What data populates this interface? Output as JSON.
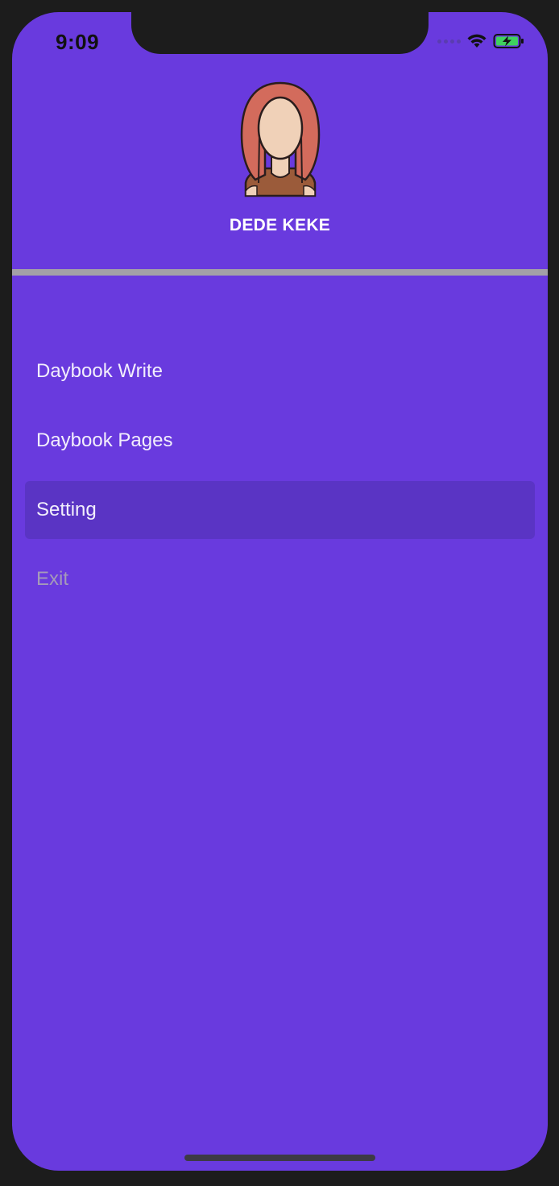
{
  "status_bar": {
    "time": "9:09",
    "icons": [
      "signal-icon",
      "wifi-icon",
      "battery-charging-icon"
    ]
  },
  "drawer": {
    "avatar_icon": "woman-avatar-icon",
    "user_name": "DEDE KEKE",
    "menu": [
      {
        "label": "Daybook Write",
        "state": "normal"
      },
      {
        "label": "Daybook Pages",
        "state": "normal"
      },
      {
        "label": "Setting",
        "state": "selected"
      },
      {
        "label": "Exit",
        "state": "disabled"
      }
    ]
  },
  "colors": {
    "background": "#693ade",
    "selected_item": "#5a34c4",
    "divider": "#a3a0a7",
    "text": "#f2eefc",
    "disabled_text": "#a59ab9"
  }
}
